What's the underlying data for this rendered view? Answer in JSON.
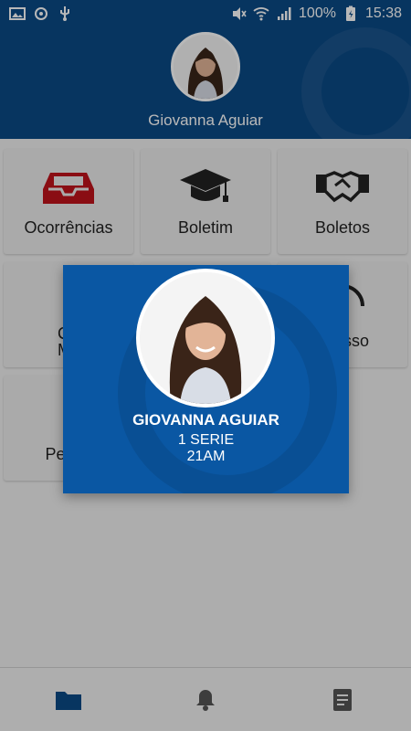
{
  "status_bar": {
    "battery": "100%",
    "time": "15:38"
  },
  "header": {
    "user_name": "Giovanna Aguiar"
  },
  "tiles": [
    {
      "label": "Ocorrências",
      "icon": "inbox-tray-icon"
    },
    {
      "label": "Boletim",
      "icon": "graduation-cap-icon"
    },
    {
      "label": "Boletos",
      "icon": "handshake-icon"
    },
    {
      "label": "Cont Minis",
      "icon": "book-icon"
    },
    {
      "label": "sso",
      "icon": "headset-icon"
    },
    {
      "label": "Penc",
      "icon": "circle-icon"
    }
  ],
  "modal": {
    "name": "GIOVANNA AGUIAR",
    "grade": "1 SERIE",
    "class": "21AM"
  },
  "nav": {
    "items": [
      "folder-icon",
      "bell-icon",
      "document-icon"
    ]
  },
  "colors": {
    "header_bg": "#0b4a86",
    "modal_bg": "#0a57a3",
    "accent_red": "#c0121b",
    "nav_active": "#0b4a86"
  }
}
